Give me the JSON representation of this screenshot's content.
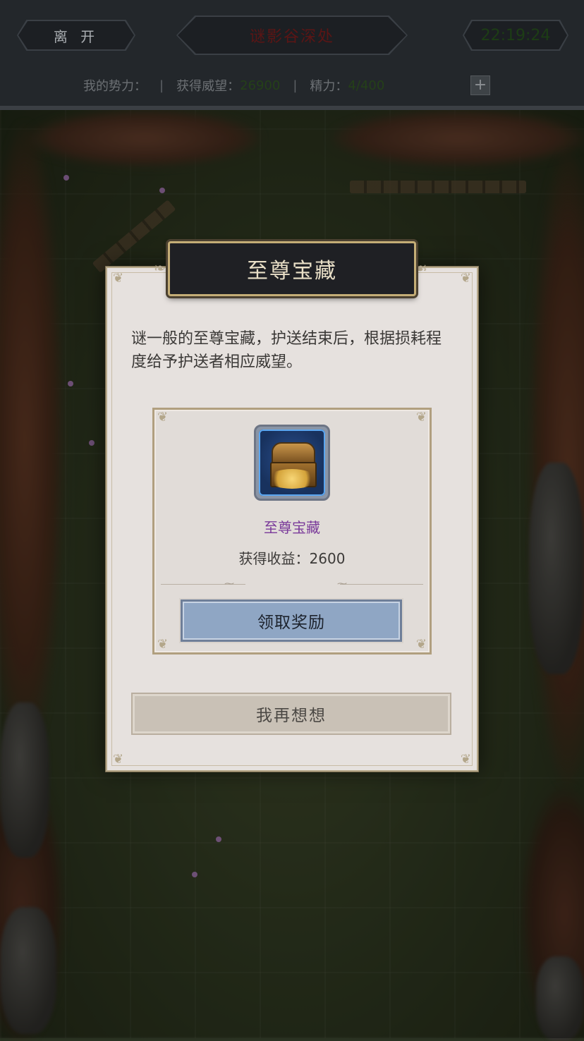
{
  "header": {
    "leave_label": "离 开",
    "location_title": "谜影谷深处",
    "clock": "22:19:24"
  },
  "stats": {
    "faction_label": "我的势力：",
    "faction_value": "",
    "prestige_label": "获得威望：",
    "prestige_value": "26900",
    "energy_label": "精力：",
    "energy_value": "4/400",
    "separator": "|",
    "plus_label": "+"
  },
  "dialog": {
    "title": "至尊宝藏",
    "description": "谜一般的至尊宝藏，护送结束后，根据损耗程度给予护送者相应威望。",
    "reward": {
      "icon": "treasure-chest-icon",
      "name": "至尊宝藏",
      "income": "获得收益：2600"
    },
    "claim_button": "领取奖励",
    "cancel_button": "我再想想"
  },
  "colors": {
    "reward_name": "#7a3a9a",
    "claim_button": "#8fa6c4",
    "dialog_bg": "#e6e1de",
    "title_bg": "#1f2024"
  }
}
